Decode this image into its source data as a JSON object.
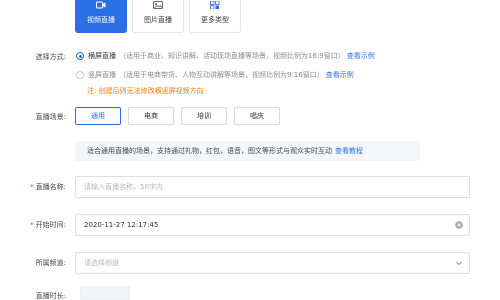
{
  "type_cards": [
    {
      "label": "视频直播",
      "icon": "video-camera-icon",
      "active": true
    },
    {
      "label": "图片直播",
      "icon": "image-icon",
      "active": false
    },
    {
      "label": "更多类型",
      "icon": "more-types-icon",
      "active": false
    }
  ],
  "mode": {
    "label": "选择方式:",
    "options": [
      {
        "title": "横屏直播",
        "desc": "（适用于商业、知识讲解、活动现场直播等场景，视频比例为16:9窗口）",
        "link": "查看示例",
        "checked": true
      },
      {
        "title": "竖屏直播",
        "desc": "（适用于电商带货、人物互动讲解等场景，视频比例为9:16窗口）",
        "link": "查看示例",
        "checked": false
      }
    ],
    "warning": "注: 创建后则无法修改横竖屏视频方向"
  },
  "scene": {
    "label": "直播场景:",
    "tabs": [
      "通用",
      "电商",
      "培训",
      "唱庆"
    ],
    "active_index": 0,
    "info": "适合通用直播的场景，支持通过礼物，红包，语音，图文等形式与观众实时互动",
    "info_link": "查看教程"
  },
  "name_field": {
    "label": "直播名称:",
    "required": true,
    "placeholder": "请输入直播名称，50字内"
  },
  "start_field": {
    "label": "开始时间:",
    "required": true,
    "value": "2020-11-27 12:17:45"
  },
  "channel_field": {
    "label": "所属频道:",
    "required": false,
    "placeholder": "请选择频道"
  },
  "duration_field": {
    "label": "直播时长:",
    "required": false
  },
  "colors": {
    "accent": "#2b6fe6",
    "warning": "#f57c00",
    "required": "#e53935"
  }
}
